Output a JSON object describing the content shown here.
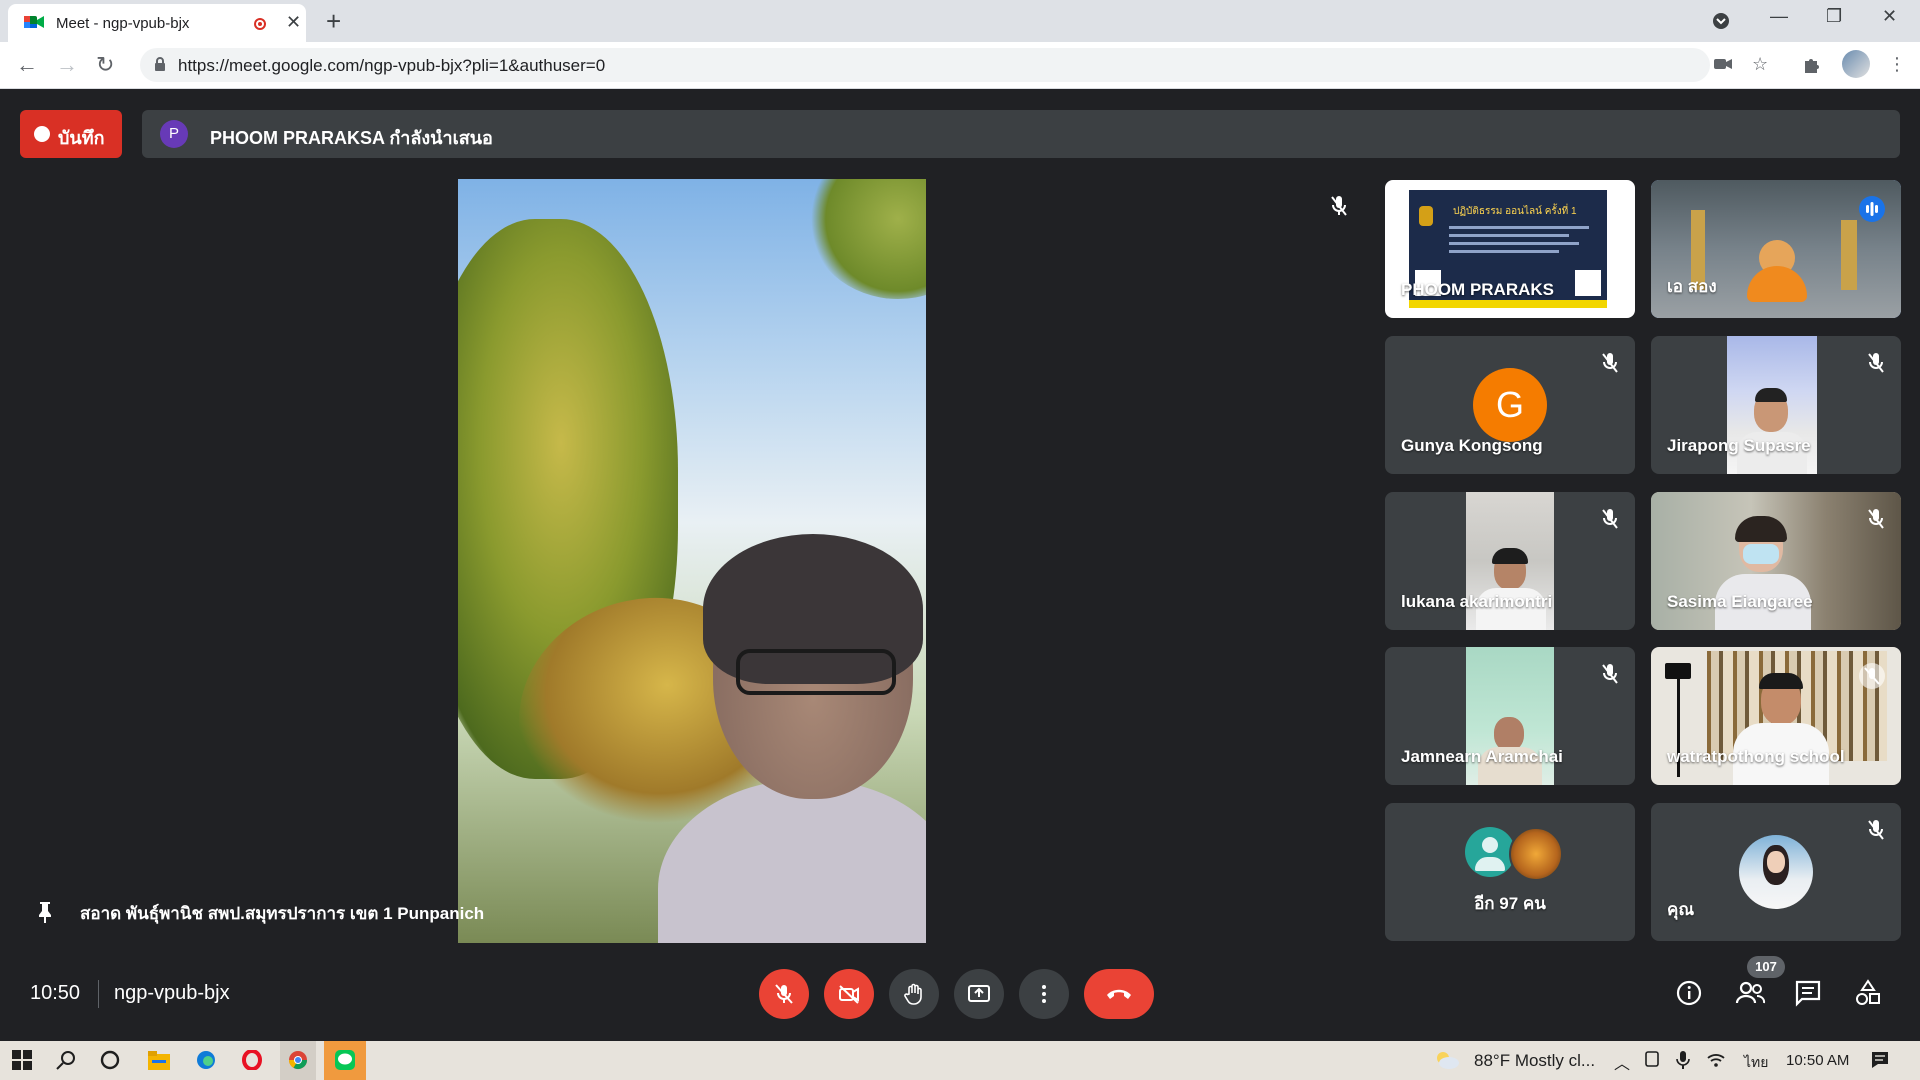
{
  "browser": {
    "tab_title": "Meet - ngp-vpub-bjx",
    "url": "https://meet.google.com/ngp-vpub-bjx?pli=1&authuser=0"
  },
  "meet": {
    "record_label": "บันทึก",
    "presenter_initial": "P",
    "presenting_text": "PHOOM PRARAKSA กำลังนำเสนอ",
    "main_speaker": "สอาด พันธุ์พานิช สพป.สมุทรปราการ เขต 1 Punpanich",
    "tiles": [
      {
        "name": "PHOOM PRARAKS"
      },
      {
        "name": "เอ สอง"
      },
      {
        "name": "Gunya Kongsong",
        "initial": "G"
      },
      {
        "name": "Jirapong Supasre"
      },
      {
        "name": "lukana akarimontri"
      },
      {
        "name": "Sasima Eiangaree"
      },
      {
        "name": "Jamnearn Aramchai"
      },
      {
        "name": "watratpothong school"
      },
      {
        "name": "อีก 97 คน"
      },
      {
        "name": "คุณ"
      }
    ],
    "slide_heading": "ปฏิบัติธรรม ออนไลน์ ครั้งที่ 1",
    "time": "10:50",
    "meeting_code": "ngp-vpub-bjx",
    "participant_count": "107"
  },
  "taskbar": {
    "weather": "88°F  Mostly cl...",
    "language": "ไทย",
    "time": "10:50 AM"
  },
  "colors": {
    "meet_background": "#202124",
    "tile_background": "#3c4043",
    "danger_red": "#ea4335",
    "record_red": "#d93025",
    "speaking_blue": "#8ab4f8",
    "gunya_avatar": "#f57c00",
    "presenter_avatar": "#673ab7"
  }
}
